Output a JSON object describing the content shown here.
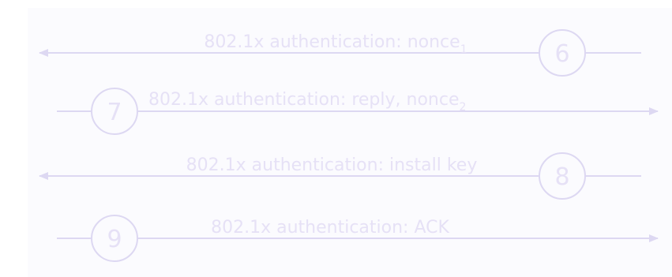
{
  "colors": {
    "line": "#ddd8f2",
    "text": "#e6e1f6",
    "background": "#ffffff",
    "panel": "#fbfbfe"
  },
  "messages": [
    {
      "step": "6",
      "label_main": "802.1x authentication: nonce",
      "label_sub": "1",
      "direction": "left"
    },
    {
      "step": "7",
      "label_main": "802.1x authentication: reply, nonce",
      "label_sub": "2",
      "direction": "right"
    },
    {
      "step": "8",
      "label_main": "802.1x authentication: install key",
      "label_sub": "",
      "direction": "left"
    },
    {
      "step": "9",
      "label_main": "802.1x authentication: ACK",
      "label_sub": "",
      "direction": "right"
    }
  ]
}
